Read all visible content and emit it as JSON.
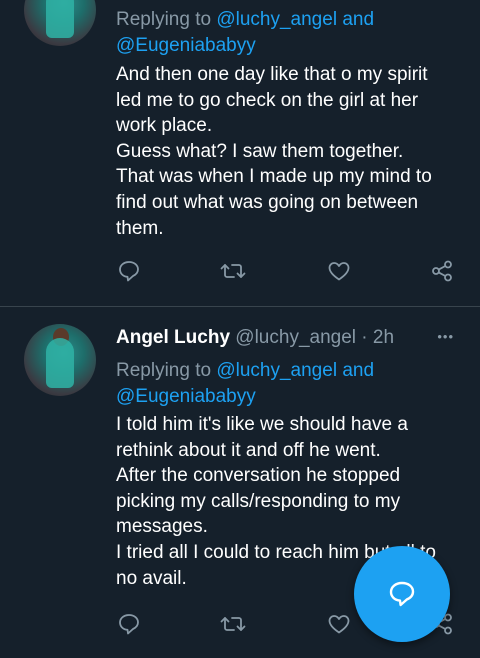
{
  "tweet1": {
    "reply_prefix": "Replying to ",
    "mention1": "@luchy_angel",
    "and": " and",
    "mention2": "@Eugeniababyy",
    "lines": [
      "And then one day like that o my spirit",
      "led me to go check on the girl at her",
      "work place.",
      "Guess what? I saw them together.",
      "That was when I made up my mind to",
      "find out what was going on between",
      "them."
    ]
  },
  "tweet2": {
    "name": "Angel Luchy",
    "handle": "@luchy_angel",
    "separator": " · ",
    "time": "2h",
    "more": "•••",
    "reply_prefix": "Replying to ",
    "mention1": "@luchy_angel",
    "and": " and",
    "mention2": "@Eugeniababyy",
    "lines": [
      "I told him it's like we should have a",
      "rethink about it and off he went.",
      "After the conversation he stopped",
      "picking my calls/responding to my",
      "messages.",
      "I tried all I could to reach him but all to",
      "no avail."
    ]
  },
  "icons": [
    "reply-icon",
    "retweet-icon",
    "like-icon",
    "share-icon",
    "compose-reply-icon"
  ],
  "colors": {
    "background": "#15202b",
    "accent": "#1da1f2",
    "muted": "#8899a6",
    "divider": "#38444d"
  }
}
